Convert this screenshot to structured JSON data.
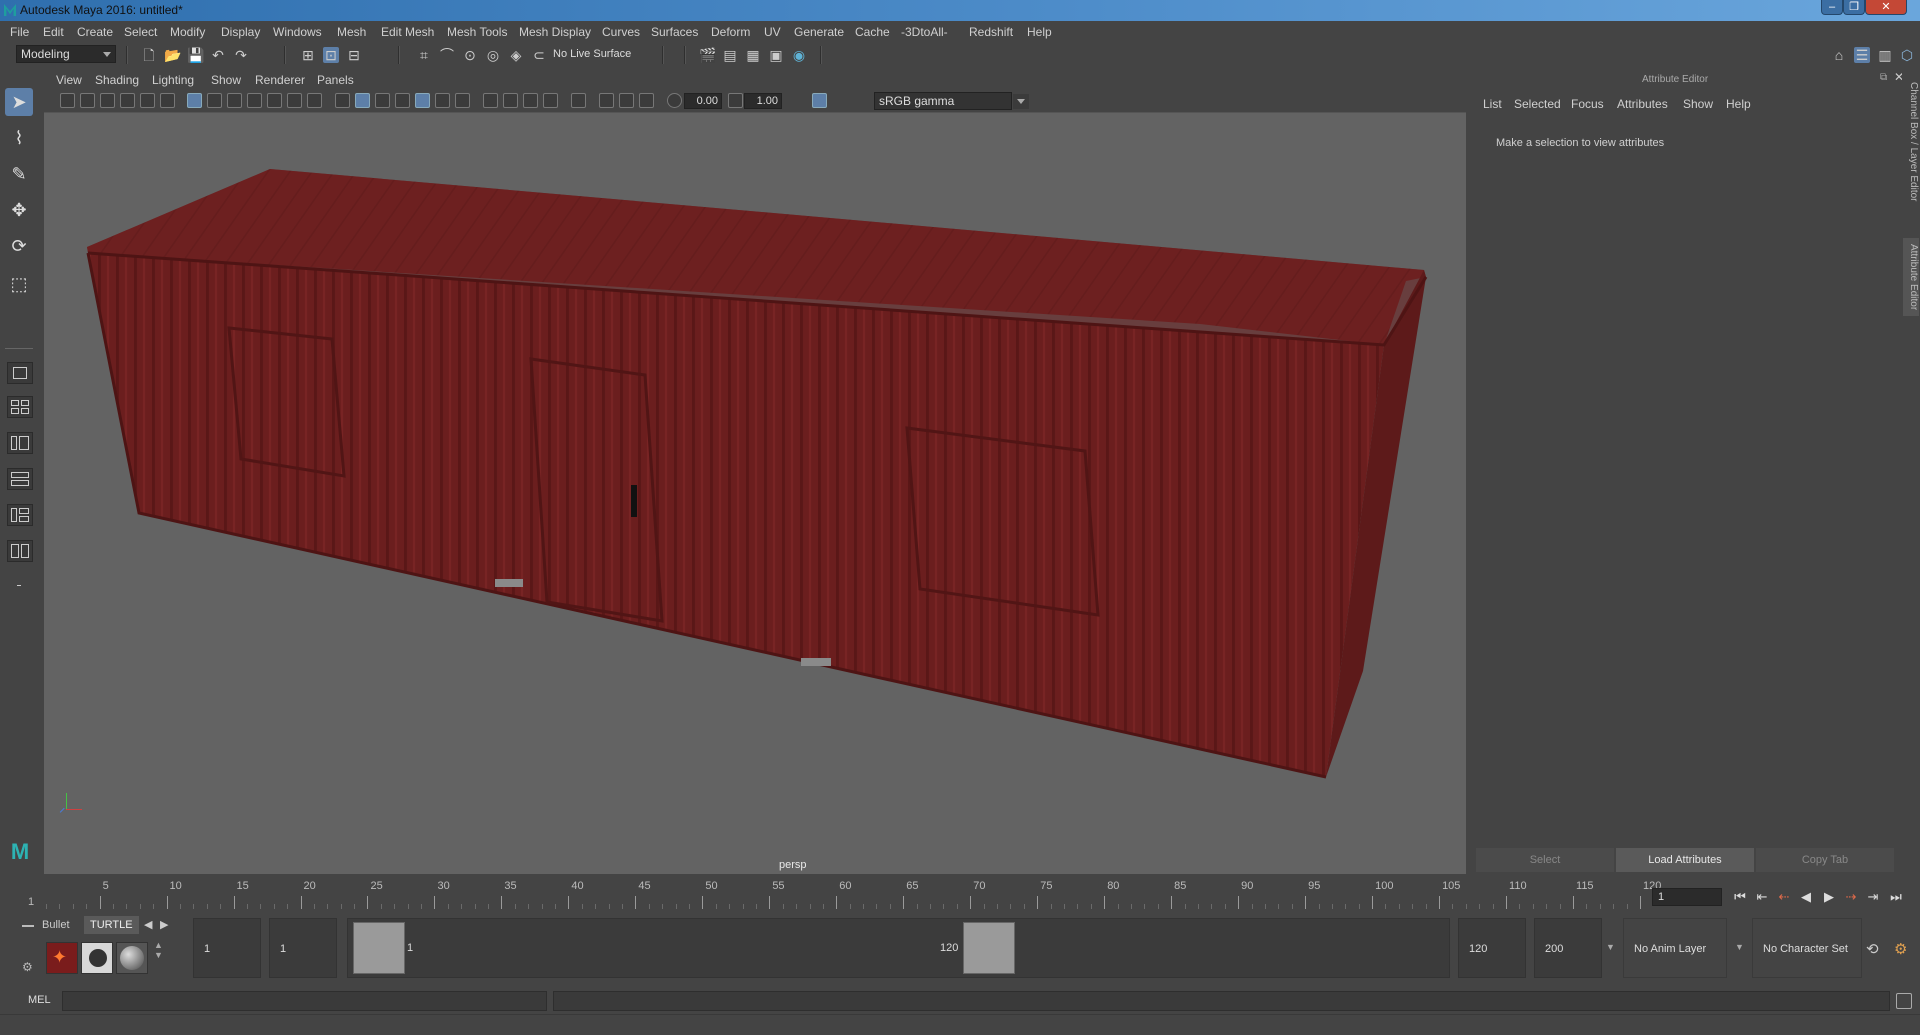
{
  "window": {
    "title": "Autodesk Maya 2016: untitled*"
  },
  "menubar": [
    "File",
    "Edit",
    "Create",
    "Select",
    "Modify",
    "Display",
    "Windows",
    "Mesh",
    "Edit Mesh",
    "Mesh Tools",
    "Mesh Display",
    "Curves",
    "Surfaces",
    "Deform",
    "UV",
    "Generate",
    "Cache",
    "-3DtoAll-",
    "Redshift",
    "Help"
  ],
  "toolbar": {
    "mode": "Modeling",
    "live_surface": "No Live Surface"
  },
  "viewport": {
    "menu": [
      "View",
      "Shading",
      "Lighting",
      "Show",
      "Renderer",
      "Panels"
    ],
    "exposure": "0.00",
    "gamma": "1.00",
    "color_management": "sRGB gamma",
    "camera_label": "persp",
    "model_color": "#6e1e1e"
  },
  "attribute_editor": {
    "title": "Attribute Editor",
    "menu": [
      "List",
      "Selected",
      "Focus",
      "Attributes",
      "Show",
      "Help"
    ],
    "message": "Make a selection to view attributes",
    "buttons": [
      "Select",
      "Load Attributes",
      "Copy Tab"
    ],
    "side_tabs": [
      "Channel Box / Layer Editor",
      "Attribute Editor"
    ]
  },
  "timeline": {
    "ticks": [
      "5",
      "10",
      "15",
      "20",
      "25",
      "30",
      "35",
      "40",
      "45",
      "50",
      "55",
      "60",
      "65",
      "70",
      "75",
      "80",
      "85",
      "90",
      "95",
      "100",
      "105",
      "110",
      "115",
      "120"
    ],
    "start_label": "1",
    "current_frame": "1"
  },
  "range": {
    "shelf_tabs": [
      "Bullet",
      "TURTLE"
    ],
    "start": "1",
    "playback_start": "1",
    "handle_start": "1",
    "handle_end": "120",
    "playback_end": "120",
    "end": "200",
    "anim_layer": "No Anim Layer",
    "character_set": "No Character Set"
  },
  "command_line": {
    "language": "MEL"
  }
}
